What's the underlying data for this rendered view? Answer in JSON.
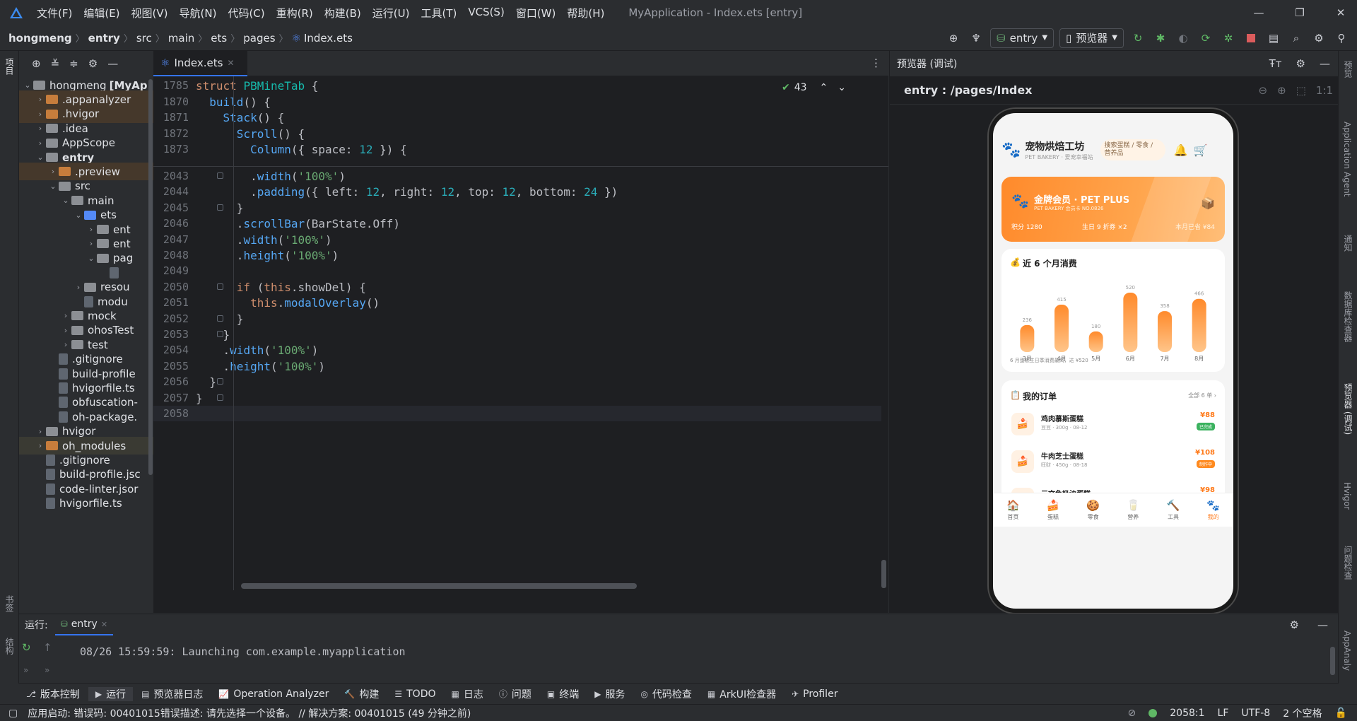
{
  "menu": [
    "文件(F)",
    "编辑(E)",
    "视图(V)",
    "导航(N)",
    "代码(C)",
    "重构(R)",
    "构建(B)",
    "运行(U)",
    "工具(T)",
    "VCS(S)",
    "窗口(W)",
    "帮助(H)"
  ],
  "window_title": "MyApplication - Index.ets [entry]",
  "breadcrumb": [
    "hongmeng",
    "entry",
    "src",
    "main",
    "ets",
    "pages",
    "Index.ets"
  ],
  "toolbar": {
    "module": "entry",
    "device": "预览器"
  },
  "project_tree": [
    {
      "label": "hongmeng",
      "bold_suffix": "[MyAp",
      "indent": 0,
      "chev": "v",
      "icon": "gray"
    },
    {
      "label": ".appanalyzer",
      "indent": 1,
      "chev": ">",
      "icon": "orange",
      "hl": "1"
    },
    {
      "label": ".hvigor",
      "indent": 1,
      "chev": ">",
      "icon": "orange",
      "hl": "1"
    },
    {
      "label": ".idea",
      "indent": 1,
      "chev": ">",
      "icon": "gray"
    },
    {
      "label": "AppScope",
      "indent": 1,
      "chev": ">",
      "icon": "gray"
    },
    {
      "label": "entry",
      "indent": 1,
      "chev": "v",
      "icon": "gray",
      "bold": "1"
    },
    {
      "label": ".preview",
      "indent": 2,
      "chev": ">",
      "icon": "orange",
      "hl": "1"
    },
    {
      "label": "src",
      "indent": 2,
      "chev": "v",
      "icon": "gray"
    },
    {
      "label": "main",
      "indent": 3,
      "chev": "v",
      "icon": "gray"
    },
    {
      "label": "ets",
      "indent": 4,
      "chev": "v",
      "icon": "blue"
    },
    {
      "label": "ent",
      "indent": 5,
      "chev": ">",
      "icon": "gray"
    },
    {
      "label": "ent",
      "indent": 5,
      "chev": ">",
      "icon": "gray"
    },
    {
      "label": "pag",
      "indent": 5,
      "chev": "v",
      "icon": "gray"
    },
    {
      "label": "",
      "indent": 6,
      "chev": "",
      "icon": "file"
    },
    {
      "label": "resou",
      "indent": 4,
      "chev": ">",
      "icon": "gray"
    },
    {
      "label": "modu",
      "indent": 4,
      "chev": "",
      "icon": "file"
    },
    {
      "label": "mock",
      "indent": 3,
      "chev": ">",
      "icon": "gray"
    },
    {
      "label": "ohosTest",
      "indent": 3,
      "chev": ">",
      "icon": "gray"
    },
    {
      "label": "test",
      "indent": 3,
      "chev": ">",
      "icon": "gray"
    },
    {
      "label": ".gitignore",
      "indent": 2,
      "chev": "",
      "icon": "file"
    },
    {
      "label": "build-profile",
      "indent": 2,
      "chev": "",
      "icon": "file"
    },
    {
      "label": "hvigorfile.ts",
      "indent": 2,
      "chev": "",
      "icon": "file"
    },
    {
      "label": "obfuscation-",
      "indent": 2,
      "chev": "",
      "icon": "file"
    },
    {
      "label": "oh-package.",
      "indent": 2,
      "chev": "",
      "icon": "file"
    },
    {
      "label": "hvigor",
      "indent": 1,
      "chev": ">",
      "icon": "gray"
    },
    {
      "label": "oh_modules",
      "indent": 1,
      "chev": ">",
      "icon": "orange",
      "hl": "2"
    },
    {
      "label": ".gitignore",
      "indent": 1,
      "chev": "",
      "icon": "file"
    },
    {
      "label": "build-profile.jsc",
      "indent": 1,
      "chev": "",
      "icon": "file"
    },
    {
      "label": "code-linter.jsor",
      "indent": 1,
      "chev": "",
      "icon": "file"
    },
    {
      "label": "hvigorfile.ts",
      "indent": 1,
      "chev": "",
      "icon": "file"
    }
  ],
  "editor": {
    "tab": "Index.ets",
    "problems": "43",
    "sticky": [
      {
        "n": "1785",
        "code": [
          [
            "kw",
            "struct "
          ],
          [
            "teal",
            "PBMineTab"
          ],
          [
            "plain",
            " {"
          ]
        ]
      },
      {
        "n": "1870",
        "code": [
          [
            "plain",
            "  "
          ],
          [
            "fn",
            "build"
          ],
          [
            "plain",
            "() {"
          ]
        ]
      },
      {
        "n": "1871",
        "code": [
          [
            "plain",
            "    "
          ],
          [
            "fn",
            "Stack"
          ],
          [
            "plain",
            "() {"
          ]
        ]
      },
      {
        "n": "1872",
        "code": [
          [
            "plain",
            "      "
          ],
          [
            "fn",
            "Scroll"
          ],
          [
            "plain",
            "() {"
          ]
        ]
      },
      {
        "n": "1873",
        "code": [
          [
            "plain",
            "        "
          ],
          [
            "fn",
            "Column"
          ],
          [
            "plain",
            "({ space: "
          ],
          [
            "num",
            "12"
          ],
          [
            "plain",
            " }) {"
          ]
        ]
      }
    ],
    "lines": [
      {
        "n": "2043",
        "code": [
          [
            "plain",
            "        ."
          ],
          [
            "fn",
            "width"
          ],
          [
            "plain",
            "("
          ],
          [
            "str",
            "'100%'"
          ],
          [
            "plain",
            ")"
          ]
        ]
      },
      {
        "n": "2044",
        "code": [
          [
            "plain",
            "        ."
          ],
          [
            "fn",
            "padding"
          ],
          [
            "plain",
            "({ left: "
          ],
          [
            "num",
            "12"
          ],
          [
            "plain",
            ", right: "
          ],
          [
            "num",
            "12"
          ],
          [
            "plain",
            ", top: "
          ],
          [
            "num",
            "12"
          ],
          [
            "plain",
            ", bottom: "
          ],
          [
            "num",
            "24"
          ],
          [
            "plain",
            " })"
          ]
        ]
      },
      {
        "n": "2045",
        "code": [
          [
            "plain",
            "      }"
          ]
        ]
      },
      {
        "n": "2046",
        "code": [
          [
            "plain",
            "      ."
          ],
          [
            "fn",
            "scrollBar"
          ],
          [
            "plain",
            "(BarState.Off)"
          ]
        ]
      },
      {
        "n": "2047",
        "code": [
          [
            "plain",
            "      ."
          ],
          [
            "fn",
            "width"
          ],
          [
            "plain",
            "("
          ],
          [
            "str",
            "'100%'"
          ],
          [
            "plain",
            ")"
          ]
        ]
      },
      {
        "n": "2048",
        "code": [
          [
            "plain",
            "      ."
          ],
          [
            "fn",
            "height"
          ],
          [
            "plain",
            "("
          ],
          [
            "str",
            "'100%'"
          ],
          [
            "plain",
            ")"
          ]
        ]
      },
      {
        "n": "2049",
        "code": [
          [
            "plain",
            ""
          ]
        ]
      },
      {
        "n": "2050",
        "code": [
          [
            "plain",
            "      "
          ],
          [
            "kw",
            "if"
          ],
          [
            "plain",
            " ("
          ],
          [
            "kw",
            "this"
          ],
          [
            "plain",
            ".showDel) {"
          ]
        ]
      },
      {
        "n": "2051",
        "code": [
          [
            "plain",
            "        "
          ],
          [
            "kw",
            "this"
          ],
          [
            "plain",
            "."
          ],
          [
            "fn",
            "modalOverlay"
          ],
          [
            "plain",
            "()"
          ]
        ]
      },
      {
        "n": "2052",
        "code": [
          [
            "plain",
            "      }"
          ]
        ]
      },
      {
        "n": "2053",
        "code": [
          [
            "plain",
            "    }"
          ]
        ]
      },
      {
        "n": "2054",
        "code": [
          [
            "plain",
            "    ."
          ],
          [
            "fn",
            "width"
          ],
          [
            "plain",
            "("
          ],
          [
            "str",
            "'100%'"
          ],
          [
            "plain",
            ")"
          ]
        ]
      },
      {
        "n": "2055",
        "code": [
          [
            "plain",
            "    ."
          ],
          [
            "fn",
            "height"
          ],
          [
            "plain",
            "("
          ],
          [
            "str",
            "'100%'"
          ],
          [
            "plain",
            ")"
          ]
        ]
      },
      {
        "n": "2056",
        "code": [
          [
            "plain",
            "  }"
          ]
        ]
      },
      {
        "n": "2057",
        "code": [
          [
            "plain",
            "}"
          ]
        ]
      },
      {
        "n": "2058",
        "code": [
          [
            "plain",
            ""
          ]
        ]
      }
    ]
  },
  "preview": {
    "title": "预览器 (调试)",
    "route": "entry : /pages/Index",
    "zoom": "1:1",
    "app": {
      "brand": "宠物烘焙工坊",
      "brand_sub": "PET BAKERY · 爱宠幸福站",
      "search": "搜索蛋糕 / 零食 / 营养品",
      "member_title": "金牌会员 · PET PLUS",
      "member_sub": "PET BAKERY 会员卡 NO.0826",
      "points": "积分 1280",
      "birthday": "生日 9 折券 ×2",
      "saved": "本月已省 ¥84",
      "spend_title": "近 6 个月消费",
      "spend_note": "6 月蛋糕生日季消费最高，达 ¥520",
      "orders_title": "我的订单",
      "orders_all": "全部 6 单 ›",
      "orders": [
        {
          "name": "鸡肉慕斯蛋糕",
          "meta": "豆豆 · 300g · 08-12",
          "price": "¥88",
          "status": "已完成",
          "status_color": "#3bb25f"
        },
        {
          "name": "牛肉芝士蛋糕",
          "meta": "旺财 · 450g · 08-18",
          "price": "¥108",
          "status": "制作中",
          "status_color": "#ff8a1f"
        },
        {
          "name": "三文鱼奶油蛋糕",
          "meta": "",
          "price": "¥98",
          "status": "",
          "status_color": "#ffb020"
        }
      ],
      "tabs": [
        {
          "label": "首页",
          "icon": "🏠",
          "active": "0"
        },
        {
          "label": "蛋糕",
          "icon": "🍰",
          "active": "0"
        },
        {
          "label": "零食",
          "icon": "🍪",
          "active": "0"
        },
        {
          "label": "营养",
          "icon": "🥛",
          "active": "0"
        },
        {
          "label": "工具",
          "icon": "🔨",
          "active": "0"
        },
        {
          "label": "我的",
          "icon": "🐾",
          "active": "1"
        }
      ]
    }
  },
  "chart_data": {
    "type": "bar",
    "title": "近 6 个月消费",
    "categories": [
      "3月",
      "4月",
      "5月",
      "6月",
      "7月",
      "8月"
    ],
    "values": [
      236,
      415,
      180,
      520,
      358,
      466
    ],
    "ylim": [
      0,
      520
    ]
  },
  "run": {
    "label": "运行:",
    "tab": "entry",
    "log": "08/26 15:59:59: Launching com.example.myapplication"
  },
  "toolwindows": [
    "版本控制",
    "运行",
    "预览器日志",
    "Operation Analyzer",
    "构建",
    "TODO",
    "日志",
    "问题",
    "终端",
    "服务",
    "代码检查",
    "ArkUI检查器",
    "Profiler"
  ],
  "left_strip": [
    "项目",
    "书签",
    "结构"
  ],
  "right_strip": [
    "预览",
    "Application Agent",
    "通知",
    "数据库检查器",
    "预览器 (调试)",
    "Hvigor",
    "问题检查",
    "AppAnaly"
  ],
  "status": {
    "message": "应用启动: 错误码: 00401015错误描述: 请先选择一个设备。 // 解决方案: 00401015 (49 分钟之前)",
    "position": "2058:1",
    "eol": "LF",
    "encoding": "UTF-8",
    "indent": "2 个空格"
  },
  "colors": {
    "accent": "#ff8a1f",
    "editor_bg": "#1e1f22",
    "panel_bg": "#2b2d30"
  }
}
